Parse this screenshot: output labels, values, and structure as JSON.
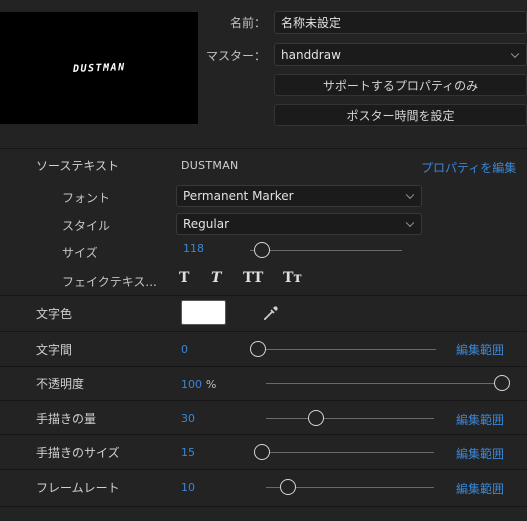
{
  "preview": {
    "text": "DUSTMAN"
  },
  "name": {
    "label": "名前：",
    "value": "名称未設定"
  },
  "master": {
    "label": "マスター：",
    "value": "handdraw"
  },
  "buttons": {
    "supported_only": "サポートするプロパティのみ",
    "poster_time": "ポスター時間を設定"
  },
  "source_text": {
    "label": "ソーステキスト",
    "value": "DUSTMAN",
    "edit_props": "プロパティを編集"
  },
  "font": {
    "label": "フォント",
    "value": "Permanent Marker"
  },
  "style": {
    "label": "スタイル",
    "value": "Regular"
  },
  "size": {
    "label": "サイズ",
    "value": "118",
    "slider_fraction": 0.08
  },
  "fake": {
    "label": "フェイクテキス...",
    "buttons": [
      "T",
      "T",
      "TT",
      "Tт"
    ]
  },
  "text_color": {
    "label": "文字色",
    "color": "#ffffff"
  },
  "tracking": {
    "label": "文字間",
    "value": "0",
    "slider_fraction": 0.0,
    "range_link": "編集範囲"
  },
  "opacity": {
    "label": "不透明度",
    "value": "100",
    "unit": "%",
    "slider_fraction": 1.0
  },
  "handdraw_amount": {
    "label": "手描きの量",
    "value": "30",
    "slider_fraction": 0.3,
    "range_link": "編集範囲"
  },
  "handdraw_size": {
    "label": "手描きのサイズ",
    "value": "15",
    "slider_fraction": 0.0,
    "range_link": "編集範囲"
  },
  "frame_rate": {
    "label": "フレームレート",
    "value": "10",
    "slider_fraction": 0.13,
    "range_link": "編集範囲"
  },
  "colors": {
    "background": "#232323",
    "accent": "#3c86d4"
  }
}
